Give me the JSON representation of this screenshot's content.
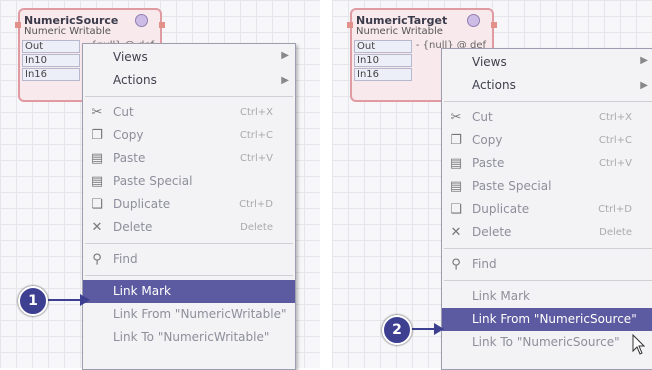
{
  "left": {
    "node": {
      "name": "NumericSource",
      "type": "Numeric Writable",
      "slots": [
        "Out",
        "In10",
        "In16"
      ],
      "out_value": "- {null} @ def"
    },
    "menu": {
      "items": [
        {
          "label": "Views",
          "icon": "",
          "shortcut": "",
          "submenu": true
        },
        {
          "label": "Actions",
          "icon": "",
          "shortcut": "",
          "submenu": true
        },
        {
          "label": "Cut",
          "icon": "scissors-icon",
          "shortcut": "Ctrl+X"
        },
        {
          "label": "Copy",
          "icon": "copy-icon",
          "shortcut": "Ctrl+C"
        },
        {
          "label": "Paste",
          "icon": "paste-icon",
          "shortcut": "Ctrl+V"
        },
        {
          "label": "Paste Special",
          "icon": "paste-special-icon",
          "shortcut": ""
        },
        {
          "label": "Duplicate",
          "icon": "duplicate-icon",
          "shortcut": "Ctrl+D"
        },
        {
          "label": "Delete",
          "icon": "delete-icon",
          "shortcut": "Delete"
        },
        {
          "label": "Find",
          "icon": "binoculars-icon",
          "shortcut": ""
        },
        {
          "label": "Link Mark",
          "highlighted": true
        },
        {
          "label": "Link From \"NumericWritable\"",
          "disabled": true
        },
        {
          "label": "Link To \"NumericWritable\"",
          "disabled": true
        }
      ]
    },
    "marker": "1"
  },
  "right": {
    "node": {
      "name": "NumericTarget",
      "type": "Numeric Writable",
      "slots": [
        "Out",
        "In10",
        "In16"
      ],
      "out_value": "- {null} @ def"
    },
    "menu": {
      "items": [
        {
          "label": "Views",
          "submenu": true
        },
        {
          "label": "Actions",
          "submenu": true
        },
        {
          "label": "Cut",
          "icon": "scissors-icon",
          "shortcut": "Ctrl+X"
        },
        {
          "label": "Copy",
          "icon": "copy-icon",
          "shortcut": "Ctrl+C"
        },
        {
          "label": "Paste",
          "icon": "paste-icon",
          "shortcut": "Ctrl+V"
        },
        {
          "label": "Paste Special",
          "icon": "paste-special-icon",
          "shortcut": ""
        },
        {
          "label": "Duplicate",
          "icon": "duplicate-icon",
          "shortcut": "Ctrl+D"
        },
        {
          "label": "Delete",
          "icon": "delete-icon",
          "shortcut": "Delete"
        },
        {
          "label": "Find",
          "icon": "binoculars-icon",
          "shortcut": ""
        },
        {
          "label": "Link Mark",
          "disabled": true
        },
        {
          "label": "Link From \"NumericSource\"",
          "highlighted": true
        },
        {
          "label": "Link To \"NumericSource\"",
          "disabled": true
        }
      ]
    },
    "marker": "2"
  },
  "colors": {
    "highlight": "#5c5aa0",
    "marker": "#3d4090",
    "node_border": "#e09aa2"
  }
}
